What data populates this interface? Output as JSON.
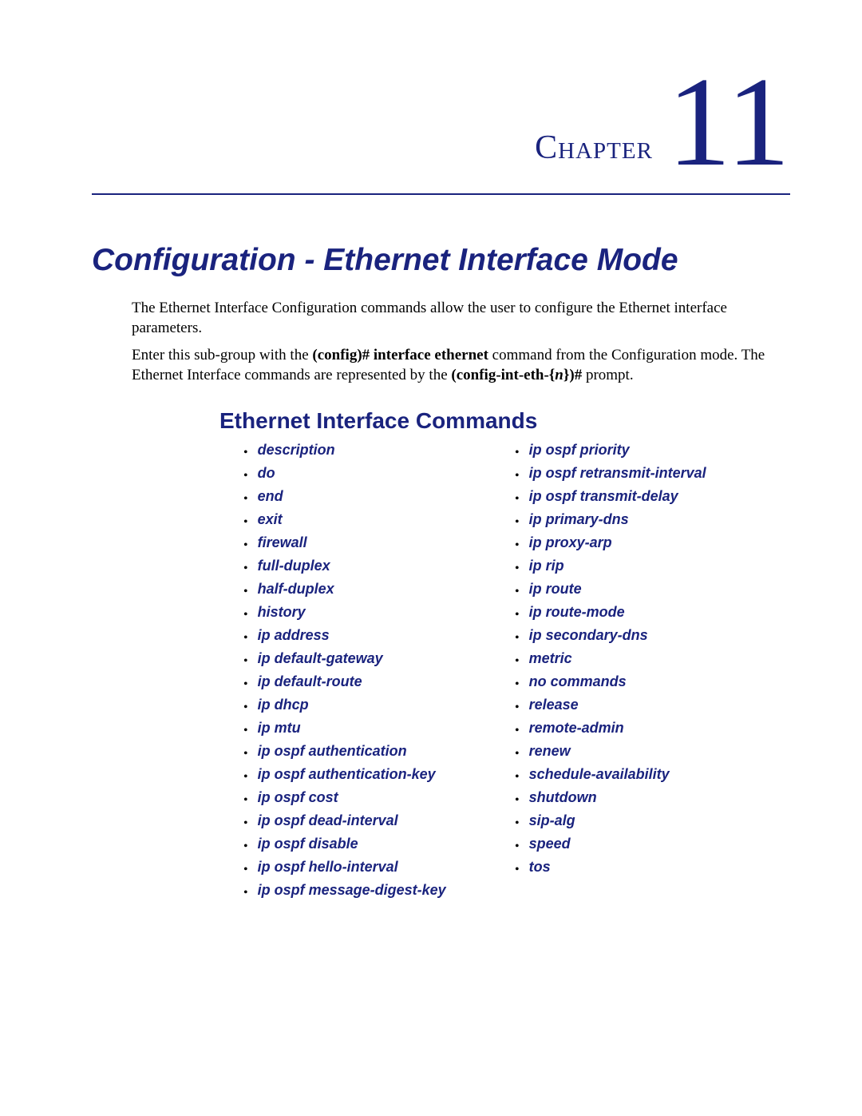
{
  "chapter": {
    "label": "Chapter",
    "number": "11"
  },
  "title": "Configuration - Ethernet Interface Mode",
  "intro": {
    "p1a": "The Ethernet Interface Configuration commands allow the user to configure the Ethernet interface parameters.",
    "p2a": "Enter this sub-group with the ",
    "cmd1": "(config)# interface ethernet",
    "p2b": " command from the Configuration mode. The Ethernet Interface commands are represented by the ",
    "cmd2a": "(config-int-eth-{",
    "n": "n",
    "cmd2b": "})#",
    "p2c": " prompt."
  },
  "subhead": "Ethernet Interface Commands",
  "left_col": [
    "description",
    "do",
    "end",
    "exit",
    "firewall",
    "full-duplex",
    "half-duplex",
    "history",
    "ip address",
    "ip default-gateway",
    "ip default-route",
    "ip dhcp",
    "ip mtu",
    "ip ospf authentication",
    "ip ospf authentication-key",
    "ip ospf cost",
    "ip ospf dead-interval",
    "ip ospf disable",
    "ip ospf hello-interval",
    "ip ospf message-digest-key"
  ],
  "right_col": [
    "ip ospf priority",
    "ip ospf retransmit-interval",
    "ip ospf transmit-delay",
    "ip primary-dns",
    "ip proxy-arp",
    "ip rip",
    "ip route",
    "ip route-mode",
    "ip secondary-dns",
    "metric",
    "no commands",
    "release",
    "remote-admin",
    "renew",
    "schedule-availability",
    "shutdown",
    "sip-alg",
    "speed",
    "tos"
  ]
}
